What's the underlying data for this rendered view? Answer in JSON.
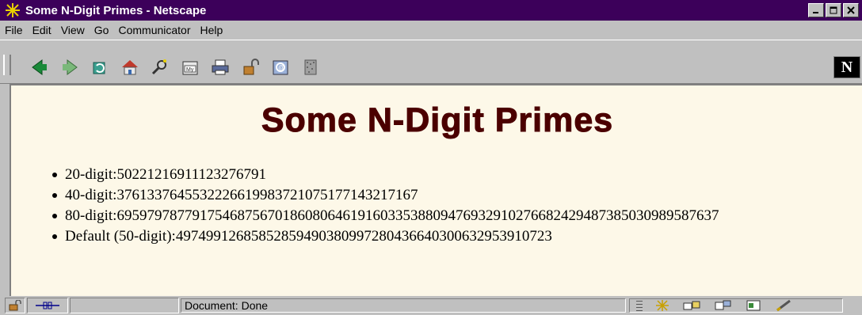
{
  "window": {
    "title": "Some N-Digit Primes - Netscape",
    "min_label": "_",
    "max_label": "□",
    "close_label": "×"
  },
  "menubar": {
    "items": [
      "File",
      "Edit",
      "View",
      "Go",
      "Communicator",
      "Help"
    ]
  },
  "toolbar": {
    "buttons": [
      "back-icon",
      "forward-icon",
      "reload-icon",
      "home-icon",
      "search-icon",
      "my-netscape-icon",
      "print-icon",
      "security-icon",
      "shop-icon",
      "stop-icon"
    ],
    "logo_letter": "N"
  },
  "page": {
    "heading": "Some N-Digit Primes",
    "primes": [
      {
        "label": "20-digit",
        "value": "50221216911123276791"
      },
      {
        "label": "40-digit",
        "value": "3761337645532226619983721075177143217167"
      },
      {
        "label": "80-digit",
        "value": "69597978779175468756701860806461916033538809476932910276682429487385030989587637"
      },
      {
        "label": "Default (50-digit)",
        "value": "49749912685852859490380997280436640300632953910723"
      }
    ]
  },
  "statusbar": {
    "text": "Document: Done"
  },
  "colors": {
    "titlebar": "#3c005a",
    "heading": "#4b0000",
    "content_bg": "#fdf8e8",
    "chrome": "#c0c0c0"
  }
}
